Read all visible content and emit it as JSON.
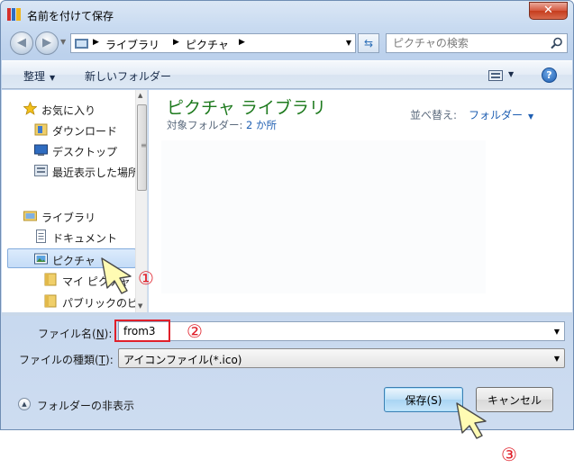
{
  "window": {
    "title": "名前を付けて保存",
    "close_label": "✕"
  },
  "address": {
    "crumbs": [
      "ライブラリ",
      "ピクチャ"
    ],
    "search_placeholder": "ピクチャの検索"
  },
  "toolbar": {
    "organize_label": "整理",
    "new_folder_label": "新しいフォルダー"
  },
  "navpane": {
    "items": [
      {
        "label": "お気に入り",
        "icon": "star-icon"
      },
      {
        "label": "ダウンロード",
        "icon": "download-folder-icon"
      },
      {
        "label": "デスクトップ",
        "icon": "desktop-icon"
      },
      {
        "label": "最近表示した場所",
        "icon": "recent-places-icon"
      },
      {
        "label": "ライブラリ",
        "icon": "library-icon"
      },
      {
        "label": "ドキュメント",
        "icon": "document-icon"
      },
      {
        "label": "ピクチャ",
        "icon": "pictures-icon",
        "selected": true
      },
      {
        "label": "マイ ピクチャ",
        "icon": "folder-icon"
      },
      {
        "label": "パブリックのピクチャ",
        "icon": "folder-icon"
      }
    ]
  },
  "content": {
    "library_title": "ピクチャ ライブラリ",
    "target_label": "対象フォルダー:",
    "target_count": "2 か所",
    "sort_label": "並べ替え:",
    "sort_value": "フォルダー"
  },
  "form": {
    "filename_label": "ファイル名(",
    "filename_key": "N",
    "filename_label_end": "):",
    "filename_value": "from3",
    "filetype_label": "ファイルの種類(",
    "filetype_key": "T",
    "filetype_label_end": "):",
    "filetype_value": "アイコンファイル(*.ico)",
    "hide_folders_label": "フォルダーの非表示",
    "save_label": "保存(S)",
    "cancel_label": "キャンセル"
  },
  "annotations": {
    "step1": "①",
    "step2": "②",
    "step3": "③",
    "accent_color": "#e0202a"
  }
}
